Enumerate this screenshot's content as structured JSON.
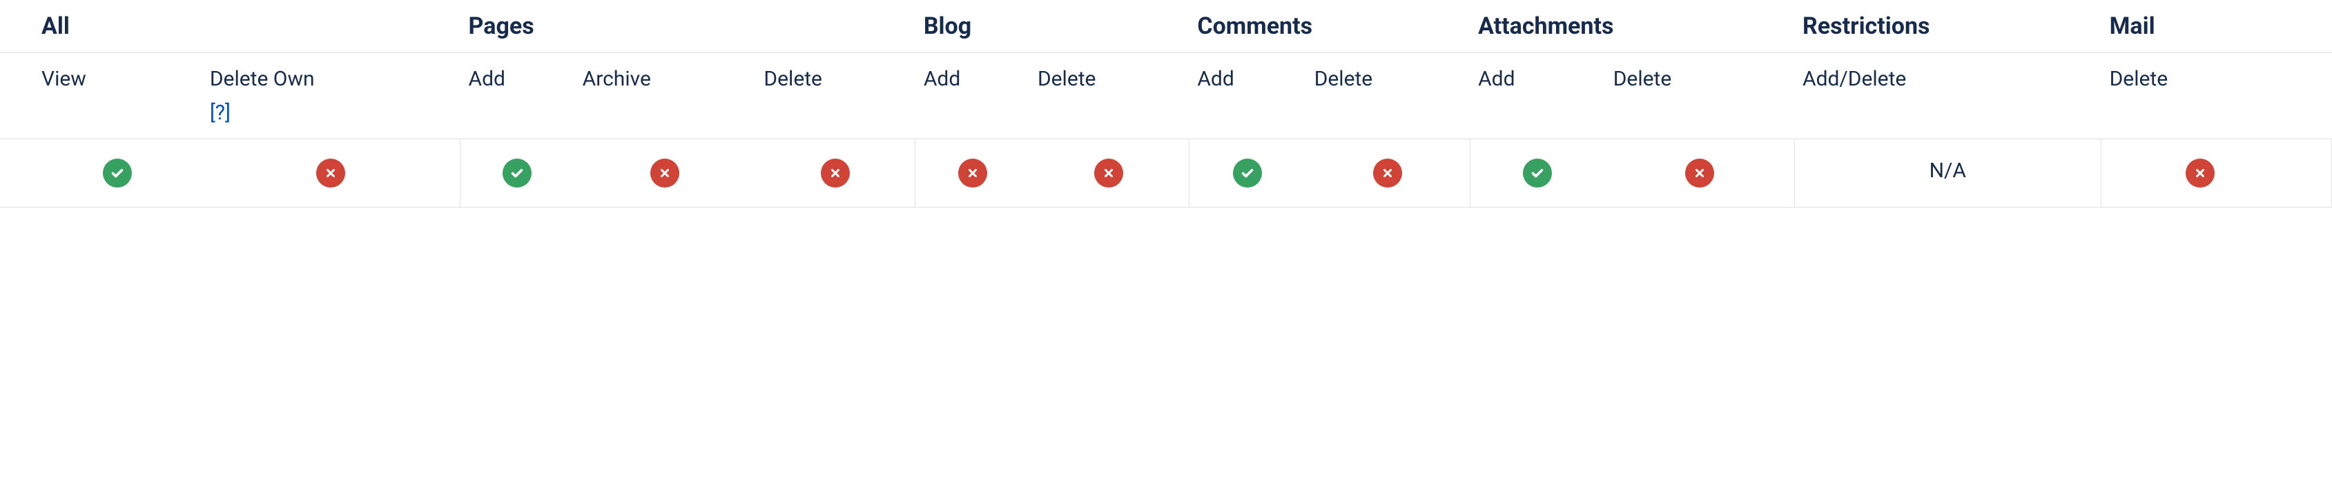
{
  "groups": {
    "all": {
      "label": "All",
      "cols": [
        "View",
        "Delete Own"
      ],
      "help_on": 1,
      "help_text": "[?]"
    },
    "pages": {
      "label": "Pages",
      "cols": [
        "Add",
        "Archive",
        "Delete"
      ]
    },
    "blog": {
      "label": "Blog",
      "cols": [
        "Add",
        "Delete"
      ]
    },
    "comments": {
      "label": "Comments",
      "cols": [
        "Add",
        "Delete"
      ]
    },
    "attachments": {
      "label": "Attachments",
      "cols": [
        "Add",
        "Delete"
      ]
    },
    "restrictions": {
      "label": "Restrictions",
      "cols": [
        "Add/Delete"
      ]
    },
    "mail": {
      "label": "Mail",
      "cols": [
        "Delete"
      ]
    }
  },
  "row": {
    "all": [
      "allow",
      "deny"
    ],
    "pages": [
      "allow",
      "deny",
      "deny"
    ],
    "blog": [
      "deny",
      "deny"
    ],
    "comments": [
      "allow",
      "deny"
    ],
    "attachments": [
      "allow",
      "deny"
    ],
    "restrictions": [
      "na"
    ],
    "mail": [
      "deny"
    ]
  },
  "na_label": "N/A"
}
